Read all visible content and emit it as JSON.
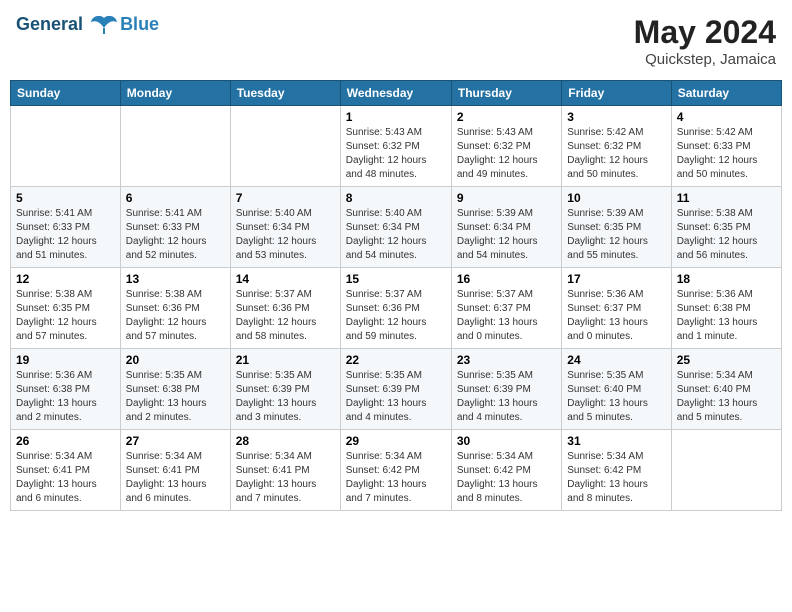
{
  "header": {
    "logo_line1": "General",
    "logo_line2": "Blue",
    "month": "May 2024",
    "location": "Quickstep, Jamaica"
  },
  "weekdays": [
    "Sunday",
    "Monday",
    "Tuesday",
    "Wednesday",
    "Thursday",
    "Friday",
    "Saturday"
  ],
  "weeks": [
    [
      {
        "day": "",
        "info": ""
      },
      {
        "day": "",
        "info": ""
      },
      {
        "day": "",
        "info": ""
      },
      {
        "day": "1",
        "info": "Sunrise: 5:43 AM\nSunset: 6:32 PM\nDaylight: 12 hours\nand 48 minutes."
      },
      {
        "day": "2",
        "info": "Sunrise: 5:43 AM\nSunset: 6:32 PM\nDaylight: 12 hours\nand 49 minutes."
      },
      {
        "day": "3",
        "info": "Sunrise: 5:42 AM\nSunset: 6:32 PM\nDaylight: 12 hours\nand 50 minutes."
      },
      {
        "day": "4",
        "info": "Sunrise: 5:42 AM\nSunset: 6:33 PM\nDaylight: 12 hours\nand 50 minutes."
      }
    ],
    [
      {
        "day": "5",
        "info": "Sunrise: 5:41 AM\nSunset: 6:33 PM\nDaylight: 12 hours\nand 51 minutes."
      },
      {
        "day": "6",
        "info": "Sunrise: 5:41 AM\nSunset: 6:33 PM\nDaylight: 12 hours\nand 52 minutes."
      },
      {
        "day": "7",
        "info": "Sunrise: 5:40 AM\nSunset: 6:34 PM\nDaylight: 12 hours\nand 53 minutes."
      },
      {
        "day": "8",
        "info": "Sunrise: 5:40 AM\nSunset: 6:34 PM\nDaylight: 12 hours\nand 54 minutes."
      },
      {
        "day": "9",
        "info": "Sunrise: 5:39 AM\nSunset: 6:34 PM\nDaylight: 12 hours\nand 54 minutes."
      },
      {
        "day": "10",
        "info": "Sunrise: 5:39 AM\nSunset: 6:35 PM\nDaylight: 12 hours\nand 55 minutes."
      },
      {
        "day": "11",
        "info": "Sunrise: 5:38 AM\nSunset: 6:35 PM\nDaylight: 12 hours\nand 56 minutes."
      }
    ],
    [
      {
        "day": "12",
        "info": "Sunrise: 5:38 AM\nSunset: 6:35 PM\nDaylight: 12 hours\nand 57 minutes."
      },
      {
        "day": "13",
        "info": "Sunrise: 5:38 AM\nSunset: 6:36 PM\nDaylight: 12 hours\nand 57 minutes."
      },
      {
        "day": "14",
        "info": "Sunrise: 5:37 AM\nSunset: 6:36 PM\nDaylight: 12 hours\nand 58 minutes."
      },
      {
        "day": "15",
        "info": "Sunrise: 5:37 AM\nSunset: 6:36 PM\nDaylight: 12 hours\nand 59 minutes."
      },
      {
        "day": "16",
        "info": "Sunrise: 5:37 AM\nSunset: 6:37 PM\nDaylight: 13 hours\nand 0 minutes."
      },
      {
        "day": "17",
        "info": "Sunrise: 5:36 AM\nSunset: 6:37 PM\nDaylight: 13 hours\nand 0 minutes."
      },
      {
        "day": "18",
        "info": "Sunrise: 5:36 AM\nSunset: 6:38 PM\nDaylight: 13 hours\nand 1 minute."
      }
    ],
    [
      {
        "day": "19",
        "info": "Sunrise: 5:36 AM\nSunset: 6:38 PM\nDaylight: 13 hours\nand 2 minutes."
      },
      {
        "day": "20",
        "info": "Sunrise: 5:35 AM\nSunset: 6:38 PM\nDaylight: 13 hours\nand 2 minutes."
      },
      {
        "day": "21",
        "info": "Sunrise: 5:35 AM\nSunset: 6:39 PM\nDaylight: 13 hours\nand 3 minutes."
      },
      {
        "day": "22",
        "info": "Sunrise: 5:35 AM\nSunset: 6:39 PM\nDaylight: 13 hours\nand 4 minutes."
      },
      {
        "day": "23",
        "info": "Sunrise: 5:35 AM\nSunset: 6:39 PM\nDaylight: 13 hours\nand 4 minutes."
      },
      {
        "day": "24",
        "info": "Sunrise: 5:35 AM\nSunset: 6:40 PM\nDaylight: 13 hours\nand 5 minutes."
      },
      {
        "day": "25",
        "info": "Sunrise: 5:34 AM\nSunset: 6:40 PM\nDaylight: 13 hours\nand 5 minutes."
      }
    ],
    [
      {
        "day": "26",
        "info": "Sunrise: 5:34 AM\nSunset: 6:41 PM\nDaylight: 13 hours\nand 6 minutes."
      },
      {
        "day": "27",
        "info": "Sunrise: 5:34 AM\nSunset: 6:41 PM\nDaylight: 13 hours\nand 6 minutes."
      },
      {
        "day": "28",
        "info": "Sunrise: 5:34 AM\nSunset: 6:41 PM\nDaylight: 13 hours\nand 7 minutes."
      },
      {
        "day": "29",
        "info": "Sunrise: 5:34 AM\nSunset: 6:42 PM\nDaylight: 13 hours\nand 7 minutes."
      },
      {
        "day": "30",
        "info": "Sunrise: 5:34 AM\nSunset: 6:42 PM\nDaylight: 13 hours\nand 8 minutes."
      },
      {
        "day": "31",
        "info": "Sunrise: 5:34 AM\nSunset: 6:42 PM\nDaylight: 13 hours\nand 8 minutes."
      },
      {
        "day": "",
        "info": ""
      }
    ]
  ]
}
